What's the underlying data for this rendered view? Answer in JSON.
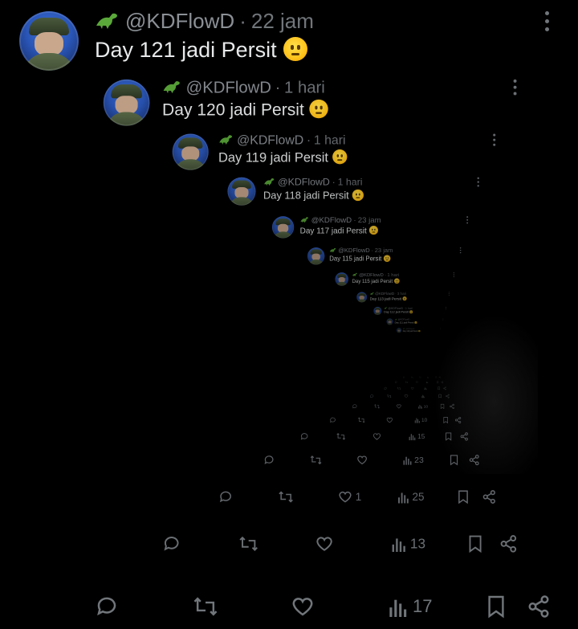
{
  "icons": {
    "dino": "dinosaur-emoji",
    "emoji": "saluting-face-emoji",
    "reply": "reply-icon",
    "repost": "repost-icon",
    "like": "heart-icon",
    "views": "views-chart-icon",
    "bookmark": "bookmark-icon",
    "share": "share-icon",
    "more": "more-vertical-icon"
  },
  "colors": {
    "background": "#000000",
    "text": "#e7e9ea",
    "muted": "#71767b",
    "avatar_accent": "#2a56b8"
  },
  "posts": [
    {
      "handle": "@KDFlowD",
      "time": "22 jam",
      "text": "Day 121 jadi Persit",
      "likes": "",
      "views": "17"
    },
    {
      "handle": "@KDFlowD",
      "time": "1 hari",
      "text": "Day 120 jadi Persit",
      "likes": "",
      "views": "13"
    },
    {
      "handle": "@KDFlowD",
      "time": "1 hari",
      "text": "Day 119 jadi Persit",
      "likes": "1",
      "views": "25"
    },
    {
      "handle": "@KDFlowD",
      "time": "1 hari",
      "text": "Day 118 jadi Persit",
      "likes": "",
      "views": "23"
    },
    {
      "handle": "@KDFlowD",
      "time": "23 jam",
      "text": "Day 117 jadi Persit",
      "likes": "",
      "views": "15"
    },
    {
      "handle": "@KDFlowD",
      "time": "23 jam",
      "text": "Day 115 jadi Persit",
      "likes": "",
      "views": "10"
    },
    {
      "handle": "@KDFlowD",
      "time": "1 hari",
      "text": "Day 115 jadi Persit",
      "likes": "",
      "views": "10"
    },
    {
      "handle": "@KDFlowD",
      "time": "3 hari",
      "text": "Day 113 jadi Persit",
      "likes": "",
      "views": ""
    },
    {
      "handle": "@KDFlowD",
      "time": "1 hari",
      "text": "Day 112 jadi Persit",
      "likes": "",
      "views": ""
    },
    {
      "handle": "@KDFlowD",
      "time": "",
      "text": "Day 111 jadi Persit",
      "likes": "",
      "views": ""
    },
    {
      "handle": "@KDFlowD",
      "time": "",
      "text": "Day 110 jadi Persit",
      "likes": "",
      "views": ""
    }
  ]
}
